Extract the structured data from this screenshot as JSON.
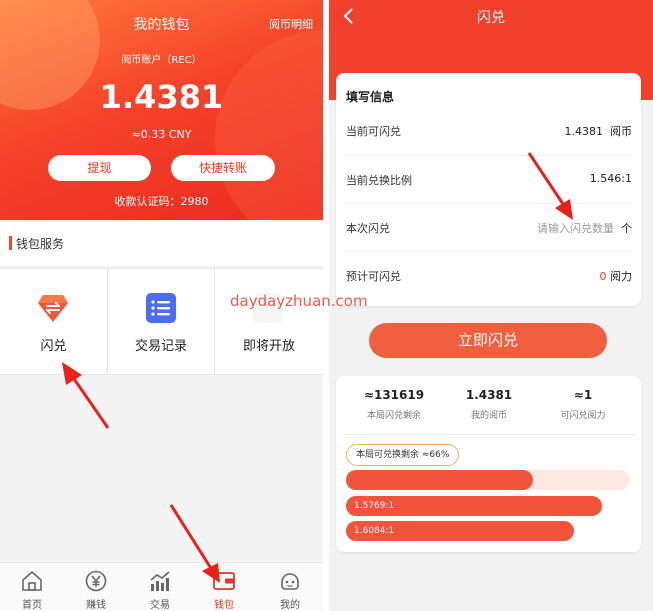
{
  "wallet": {
    "title": "我的钱包",
    "detail_link": "阅币明细",
    "account_label": "阅币账户（REC）",
    "balance": "1.4381",
    "cny": "≈0.33 CNY",
    "withdraw": "提现",
    "transfer": "快捷转账",
    "code": "收款认证码：2980"
  },
  "services": {
    "header": "钱包服务",
    "items": [
      {
        "label": "闪兑"
      },
      {
        "label": "交易记录"
      },
      {
        "label": "即将开放"
      }
    ]
  },
  "tabbar": {
    "items": [
      {
        "label": "首页"
      },
      {
        "label": "赚钱"
      },
      {
        "label": "交易"
      },
      {
        "label": "钱包"
      },
      {
        "label": "我的"
      }
    ],
    "active": "钱包"
  },
  "watermark": "daydayzhuan.com",
  "exchange": {
    "title": "闪兑",
    "form_title": "填写信息",
    "rows": {
      "available": {
        "label": "当前可闪兑",
        "value": "1.4381",
        "unit": "阅币"
      },
      "ratio": {
        "label": "当前兑换比例",
        "value": "1.546:1"
      },
      "amount": {
        "label": "本次闪兑",
        "placeholder": "请输入闪兑数量",
        "unit": "个"
      },
      "estimate": {
        "label": "预计可闪兑",
        "value": "0",
        "unit": "阅力"
      }
    },
    "submit": "立即闪兑"
  },
  "pool": {
    "stats": [
      {
        "value": "≈131619",
        "label": "本局闪兑剩余"
      },
      {
        "value": "1.4381",
        "label": "我的阅币"
      },
      {
        "value": "≈1",
        "label": "可闪兑阅力"
      }
    ],
    "remaining_pill": "本局可兑换剩余 ≈66%",
    "remaining_pct": 66,
    "levels": [
      "1.5769:1",
      "1.6084:1"
    ]
  },
  "colors": {
    "brand_red": "#f1402c",
    "accent_orange": "#f0603e",
    "bar_red": "#f0543a"
  }
}
